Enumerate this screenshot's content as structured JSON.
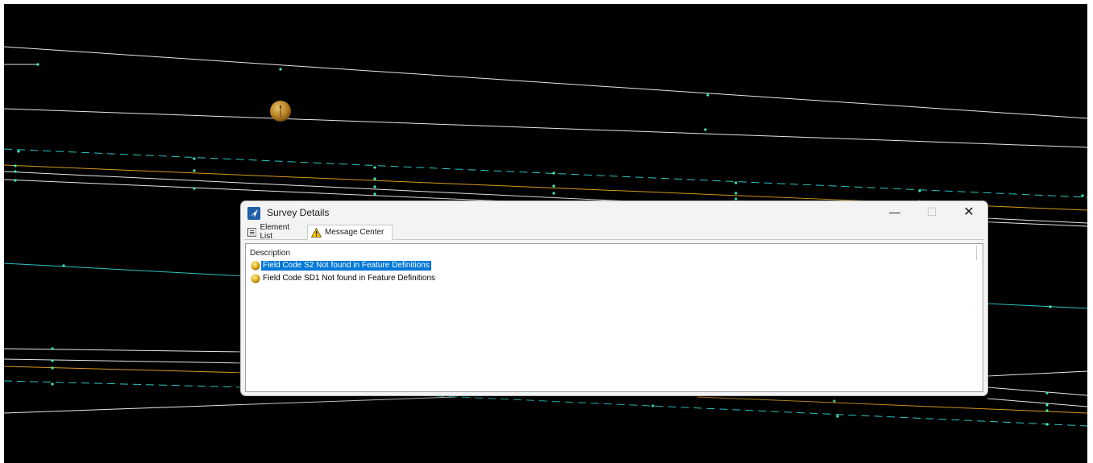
{
  "window": {
    "title": "Survey Details",
    "minimize_glyph": "—",
    "maximize_glyph": "☐",
    "close_glyph": "✕"
  },
  "tabs": [
    {
      "label": "Element List",
      "icon": "list-icon",
      "active": false
    },
    {
      "label": "Message Center",
      "icon": "warning-icon",
      "active": true
    }
  ],
  "message_list": {
    "column_header": "Description",
    "rows": [
      {
        "text": "Field Code S2 Not found in Feature Definitions",
        "icon": "bulb-icon",
        "selected": true
      },
      {
        "text": "Field Code SD1 Not found in Feature Definitions",
        "icon": "bulb-icon",
        "selected": false
      }
    ]
  },
  "colors": {
    "canvas_background": "#000000",
    "white_line": "#e6e6e6",
    "cyan_line": "#2ec4c4",
    "orange_line": "#d79a1e",
    "vertex": "#3ff0b4",
    "selection": "#0078d7"
  }
}
